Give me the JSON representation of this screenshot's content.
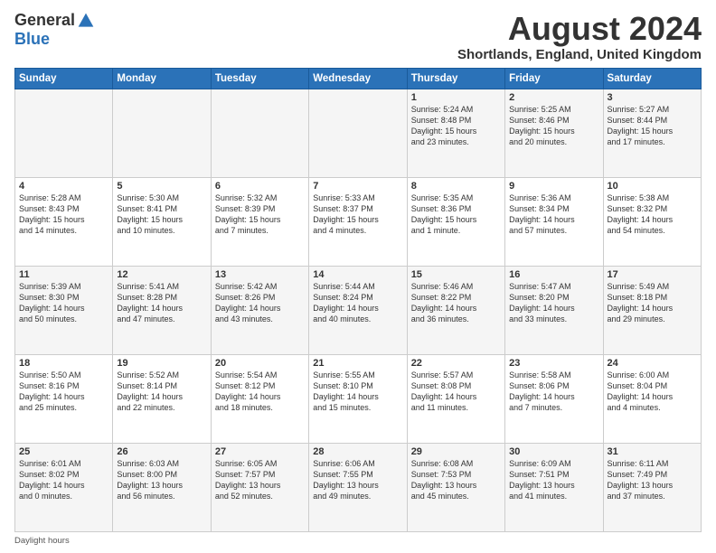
{
  "header": {
    "logo_general": "General",
    "logo_blue": "Blue",
    "month_title": "August 2024",
    "location": "Shortlands, England, United Kingdom"
  },
  "days_of_week": [
    "Sunday",
    "Monday",
    "Tuesday",
    "Wednesday",
    "Thursday",
    "Friday",
    "Saturday"
  ],
  "weeks": [
    [
      {
        "day": "",
        "info": ""
      },
      {
        "day": "",
        "info": ""
      },
      {
        "day": "",
        "info": ""
      },
      {
        "day": "",
        "info": ""
      },
      {
        "day": "1",
        "info": "Sunrise: 5:24 AM\nSunset: 8:48 PM\nDaylight: 15 hours\nand 23 minutes."
      },
      {
        "day": "2",
        "info": "Sunrise: 5:25 AM\nSunset: 8:46 PM\nDaylight: 15 hours\nand 20 minutes."
      },
      {
        "day": "3",
        "info": "Sunrise: 5:27 AM\nSunset: 8:44 PM\nDaylight: 15 hours\nand 17 minutes."
      }
    ],
    [
      {
        "day": "4",
        "info": "Sunrise: 5:28 AM\nSunset: 8:43 PM\nDaylight: 15 hours\nand 14 minutes."
      },
      {
        "day": "5",
        "info": "Sunrise: 5:30 AM\nSunset: 8:41 PM\nDaylight: 15 hours\nand 10 minutes."
      },
      {
        "day": "6",
        "info": "Sunrise: 5:32 AM\nSunset: 8:39 PM\nDaylight: 15 hours\nand 7 minutes."
      },
      {
        "day": "7",
        "info": "Sunrise: 5:33 AM\nSunset: 8:37 PM\nDaylight: 15 hours\nand 4 minutes."
      },
      {
        "day": "8",
        "info": "Sunrise: 5:35 AM\nSunset: 8:36 PM\nDaylight: 15 hours\nand 1 minute."
      },
      {
        "day": "9",
        "info": "Sunrise: 5:36 AM\nSunset: 8:34 PM\nDaylight: 14 hours\nand 57 minutes."
      },
      {
        "day": "10",
        "info": "Sunrise: 5:38 AM\nSunset: 8:32 PM\nDaylight: 14 hours\nand 54 minutes."
      }
    ],
    [
      {
        "day": "11",
        "info": "Sunrise: 5:39 AM\nSunset: 8:30 PM\nDaylight: 14 hours\nand 50 minutes."
      },
      {
        "day": "12",
        "info": "Sunrise: 5:41 AM\nSunset: 8:28 PM\nDaylight: 14 hours\nand 47 minutes."
      },
      {
        "day": "13",
        "info": "Sunrise: 5:42 AM\nSunset: 8:26 PM\nDaylight: 14 hours\nand 43 minutes."
      },
      {
        "day": "14",
        "info": "Sunrise: 5:44 AM\nSunset: 8:24 PM\nDaylight: 14 hours\nand 40 minutes."
      },
      {
        "day": "15",
        "info": "Sunrise: 5:46 AM\nSunset: 8:22 PM\nDaylight: 14 hours\nand 36 minutes."
      },
      {
        "day": "16",
        "info": "Sunrise: 5:47 AM\nSunset: 8:20 PM\nDaylight: 14 hours\nand 33 minutes."
      },
      {
        "day": "17",
        "info": "Sunrise: 5:49 AM\nSunset: 8:18 PM\nDaylight: 14 hours\nand 29 minutes."
      }
    ],
    [
      {
        "day": "18",
        "info": "Sunrise: 5:50 AM\nSunset: 8:16 PM\nDaylight: 14 hours\nand 25 minutes."
      },
      {
        "day": "19",
        "info": "Sunrise: 5:52 AM\nSunset: 8:14 PM\nDaylight: 14 hours\nand 22 minutes."
      },
      {
        "day": "20",
        "info": "Sunrise: 5:54 AM\nSunset: 8:12 PM\nDaylight: 14 hours\nand 18 minutes."
      },
      {
        "day": "21",
        "info": "Sunrise: 5:55 AM\nSunset: 8:10 PM\nDaylight: 14 hours\nand 15 minutes."
      },
      {
        "day": "22",
        "info": "Sunrise: 5:57 AM\nSunset: 8:08 PM\nDaylight: 14 hours\nand 11 minutes."
      },
      {
        "day": "23",
        "info": "Sunrise: 5:58 AM\nSunset: 8:06 PM\nDaylight: 14 hours\nand 7 minutes."
      },
      {
        "day": "24",
        "info": "Sunrise: 6:00 AM\nSunset: 8:04 PM\nDaylight: 14 hours\nand 4 minutes."
      }
    ],
    [
      {
        "day": "25",
        "info": "Sunrise: 6:01 AM\nSunset: 8:02 PM\nDaylight: 14 hours\nand 0 minutes."
      },
      {
        "day": "26",
        "info": "Sunrise: 6:03 AM\nSunset: 8:00 PM\nDaylight: 13 hours\nand 56 minutes."
      },
      {
        "day": "27",
        "info": "Sunrise: 6:05 AM\nSunset: 7:57 PM\nDaylight: 13 hours\nand 52 minutes."
      },
      {
        "day": "28",
        "info": "Sunrise: 6:06 AM\nSunset: 7:55 PM\nDaylight: 13 hours\nand 49 minutes."
      },
      {
        "day": "29",
        "info": "Sunrise: 6:08 AM\nSunset: 7:53 PM\nDaylight: 13 hours\nand 45 minutes."
      },
      {
        "day": "30",
        "info": "Sunrise: 6:09 AM\nSunset: 7:51 PM\nDaylight: 13 hours\nand 41 minutes."
      },
      {
        "day": "31",
        "info": "Sunrise: 6:11 AM\nSunset: 7:49 PM\nDaylight: 13 hours\nand 37 minutes."
      }
    ]
  ],
  "footer": {
    "note": "Daylight hours"
  }
}
